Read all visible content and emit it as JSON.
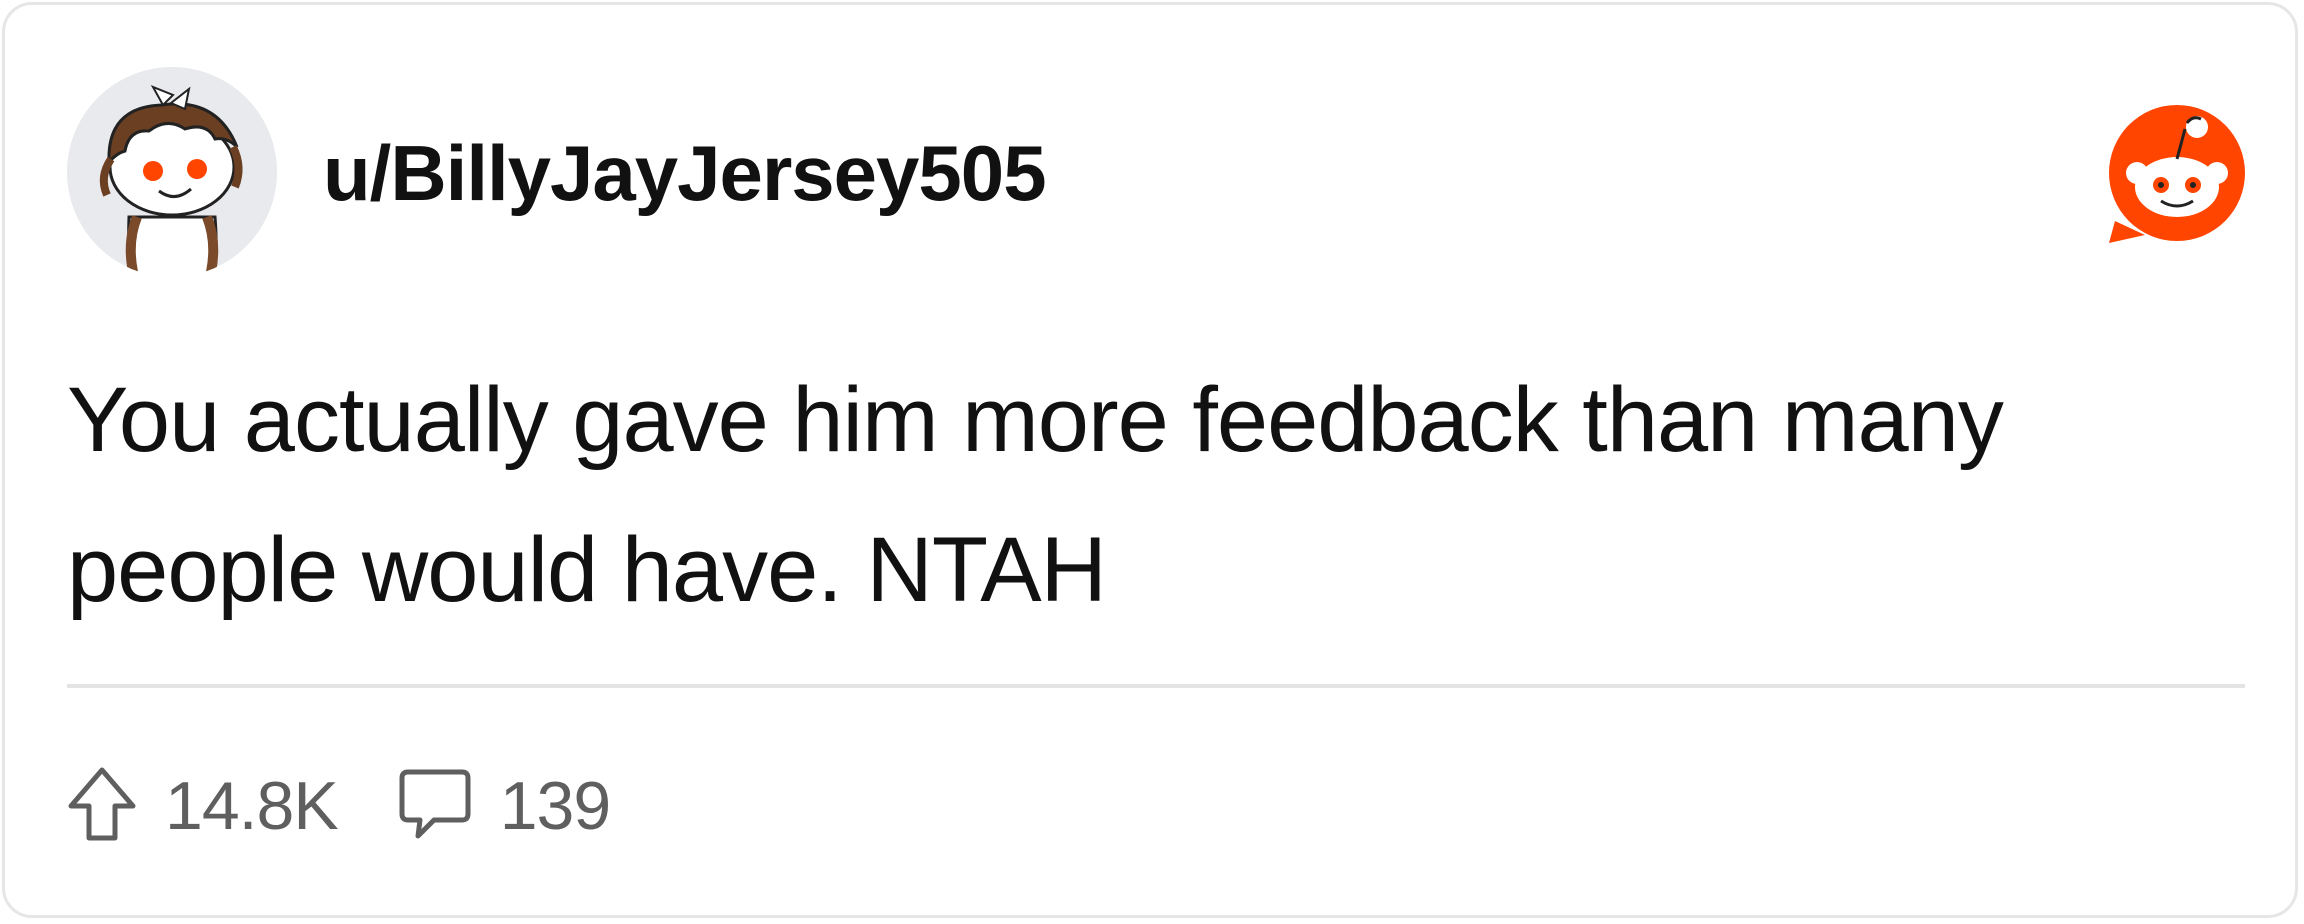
{
  "post": {
    "username": "u/BillyJayJersey505",
    "body_line_1": "You actually gave him more feedback than many",
    "body_line_2": "people would have. NTAH"
  },
  "footer": {
    "upvotes": "14.8K",
    "comments": "139"
  },
  "icons": {
    "avatar": "snoo-avatar-icon",
    "brand": "reddit-logo-icon",
    "upvote": "upvote-arrow-icon",
    "comment": "comment-bubble-icon"
  },
  "colors": {
    "brand": "#ff4500",
    "text": "#111111",
    "muted": "#5f5f5f",
    "border": "#e6e6e6"
  }
}
